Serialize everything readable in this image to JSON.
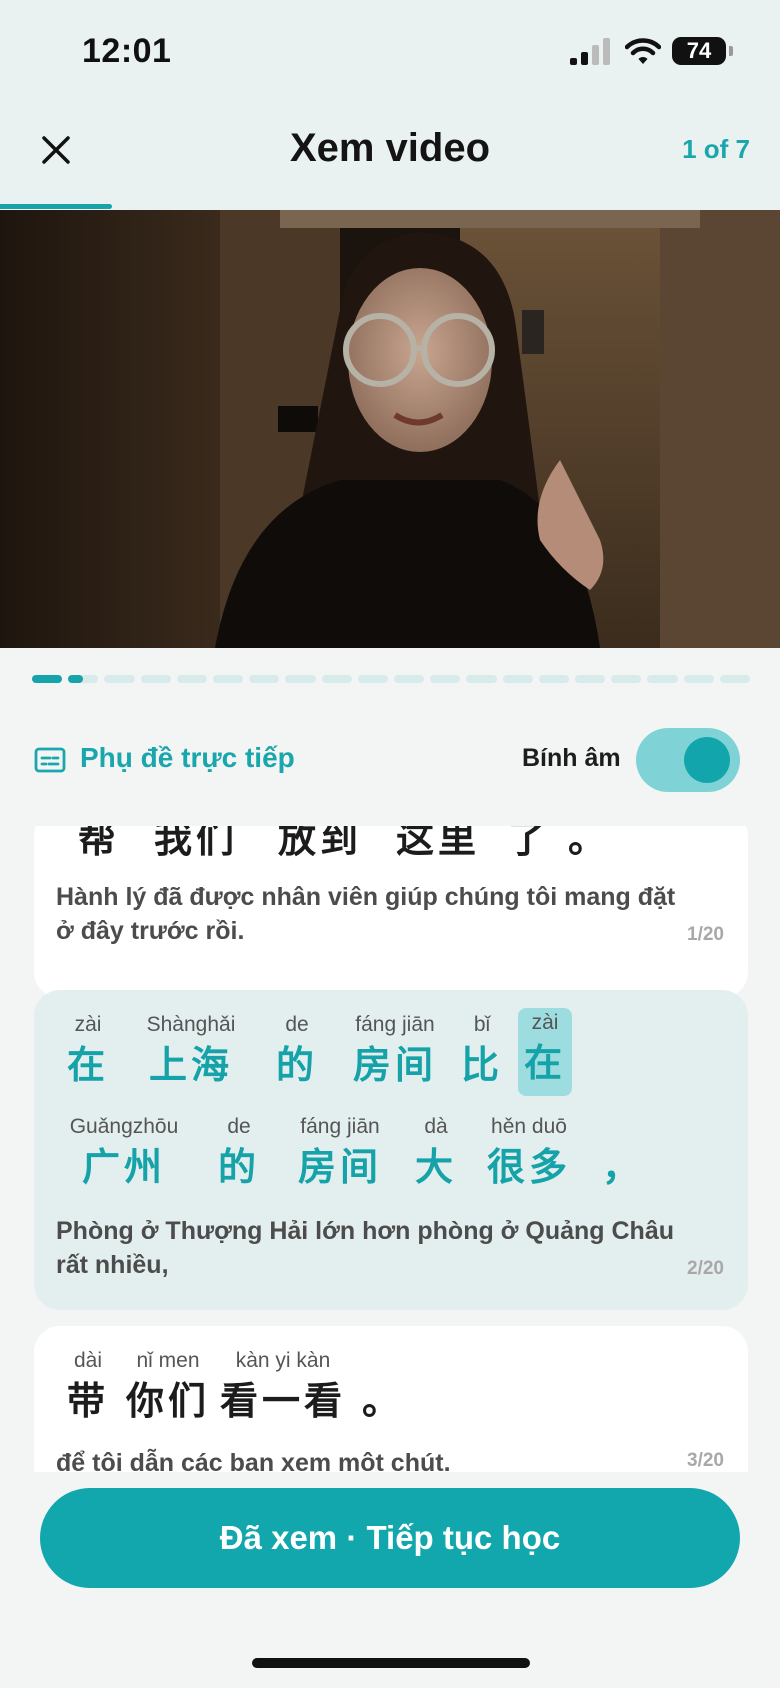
{
  "status": {
    "time": "12:01",
    "battery": "74"
  },
  "header": {
    "title": "Xem video",
    "counter": "1 of 7"
  },
  "playback": {
    "segments_total": 20,
    "current_segment": 2,
    "current_segment_progress": 0.5
  },
  "controls": {
    "subtitle_label": "Phụ đề trực tiếp",
    "pinyin_label": "Bính âm",
    "pinyin_enabled": true
  },
  "sentences": [
    {
      "words": [
        {
          "py": "",
          "hz": "帮"
        },
        {
          "py": "",
          "hz": "我们"
        },
        {
          "py": "",
          "hz": "放到"
        },
        {
          "py": "",
          "hz": "这里"
        },
        {
          "py": "",
          "hz": "了"
        },
        {
          "py": "",
          "hz": "。"
        }
      ],
      "translation": "Hành lý đã được nhân viên giúp chúng tôi mang đặt ở đây trước rồi.",
      "index": "1/20"
    },
    {
      "words": [
        {
          "py": "zài",
          "hz": "在"
        },
        {
          "py": "Shànghǎi",
          "hz": "上海"
        },
        {
          "py": "de",
          "hz": "的"
        },
        {
          "py": "fáng jiān",
          "hz": "房间"
        },
        {
          "py": "bǐ",
          "hz": "比"
        },
        {
          "py": "zài",
          "hz": "在"
        },
        {
          "py": "Guǎngzhōu",
          "hz": "广州"
        },
        {
          "py": "de",
          "hz": "的"
        },
        {
          "py": "fáng jiān",
          "hz": "房间"
        },
        {
          "py": "dà",
          "hz": "大"
        },
        {
          "py": "hěn duō",
          "hz": "很多"
        },
        {
          "py": "",
          "hz": "，"
        }
      ],
      "translation": "Phòng ở Thượng Hải lớn hơn phòng ở Quảng Châu rất nhiều,",
      "index": "2/20",
      "active": true,
      "highlight_word": 5
    },
    {
      "words": [
        {
          "py": "dài",
          "hz": "带"
        },
        {
          "py": "nǐ men",
          "hz": "你们"
        },
        {
          "py": "kàn yi kàn",
          "hz": "看一看"
        },
        {
          "py": "",
          "hz": "。"
        }
      ],
      "translation": "để tôi dẫn các bạn xem một chút.",
      "index": "3/20"
    }
  ],
  "cta": {
    "label": "Đã xem · Tiếp tục học"
  }
}
